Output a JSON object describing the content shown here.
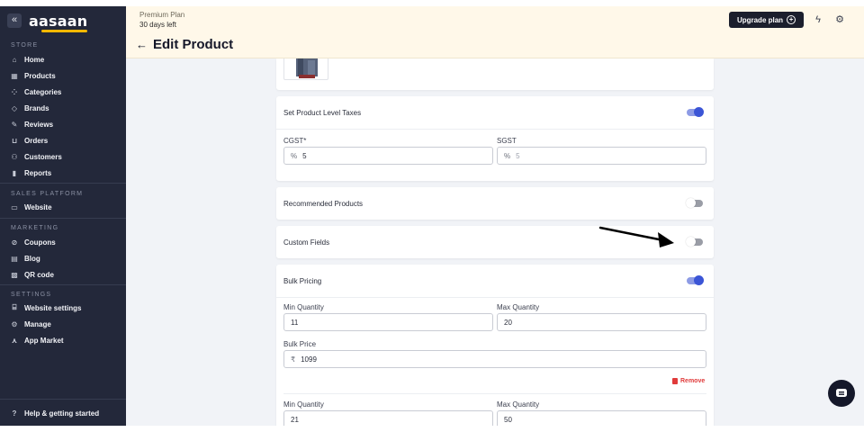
{
  "sidebar": {
    "logo": "aasaan",
    "sections": {
      "store": "STORE",
      "sales": "SALES PLATFORM",
      "marketing": "MARKETING",
      "settings": "SETTINGS"
    },
    "items": {
      "home": "Home",
      "products": "Products",
      "categories": "Categories",
      "brands": "Brands",
      "reviews": "Reviews",
      "orders": "Orders",
      "customers": "Customers",
      "reports": "Reports",
      "website": "Website",
      "coupons": "Coupons",
      "blog": "Blog",
      "qr": "QR code",
      "website_settings": "Website settings",
      "manage": "Manage",
      "app_market": "App Market",
      "help": "Help & getting started"
    }
  },
  "header": {
    "plan_name": "Premium Plan",
    "plan_days": "30 days left",
    "upgrade_label": "Upgrade plan",
    "title": "Edit Product"
  },
  "taxes": {
    "title": "Set Product Level Taxes",
    "toggle_on": true,
    "cgst_label": "CGST*",
    "cgst_prefix": "%",
    "cgst_value": "5",
    "sgst_label": "SGST",
    "sgst_prefix": "%",
    "sgst_placeholder": "5"
  },
  "recommended": {
    "title": "Recommended Products",
    "toggle_on": false
  },
  "custom_fields": {
    "title": "Custom Fields",
    "toggle_on": false
  },
  "bulk": {
    "title": "Bulk Pricing",
    "toggle_on": true,
    "tiers": [
      {
        "min_label": "Min Quantity",
        "min": "11",
        "max_label": "Max Quantity",
        "max": "20",
        "price_label": "Bulk Price",
        "currency": "₹",
        "price": "1099"
      },
      {
        "min_label": "Min Quantity",
        "min": "21",
        "max_label": "Max Quantity",
        "max": "50"
      }
    ],
    "remove_label": "Remove"
  },
  "colors": {
    "sidebar_bg": "#23283a",
    "banner_bg": "#fff8e9",
    "accent": "#3b55d6",
    "danger": "#e03a3a"
  }
}
